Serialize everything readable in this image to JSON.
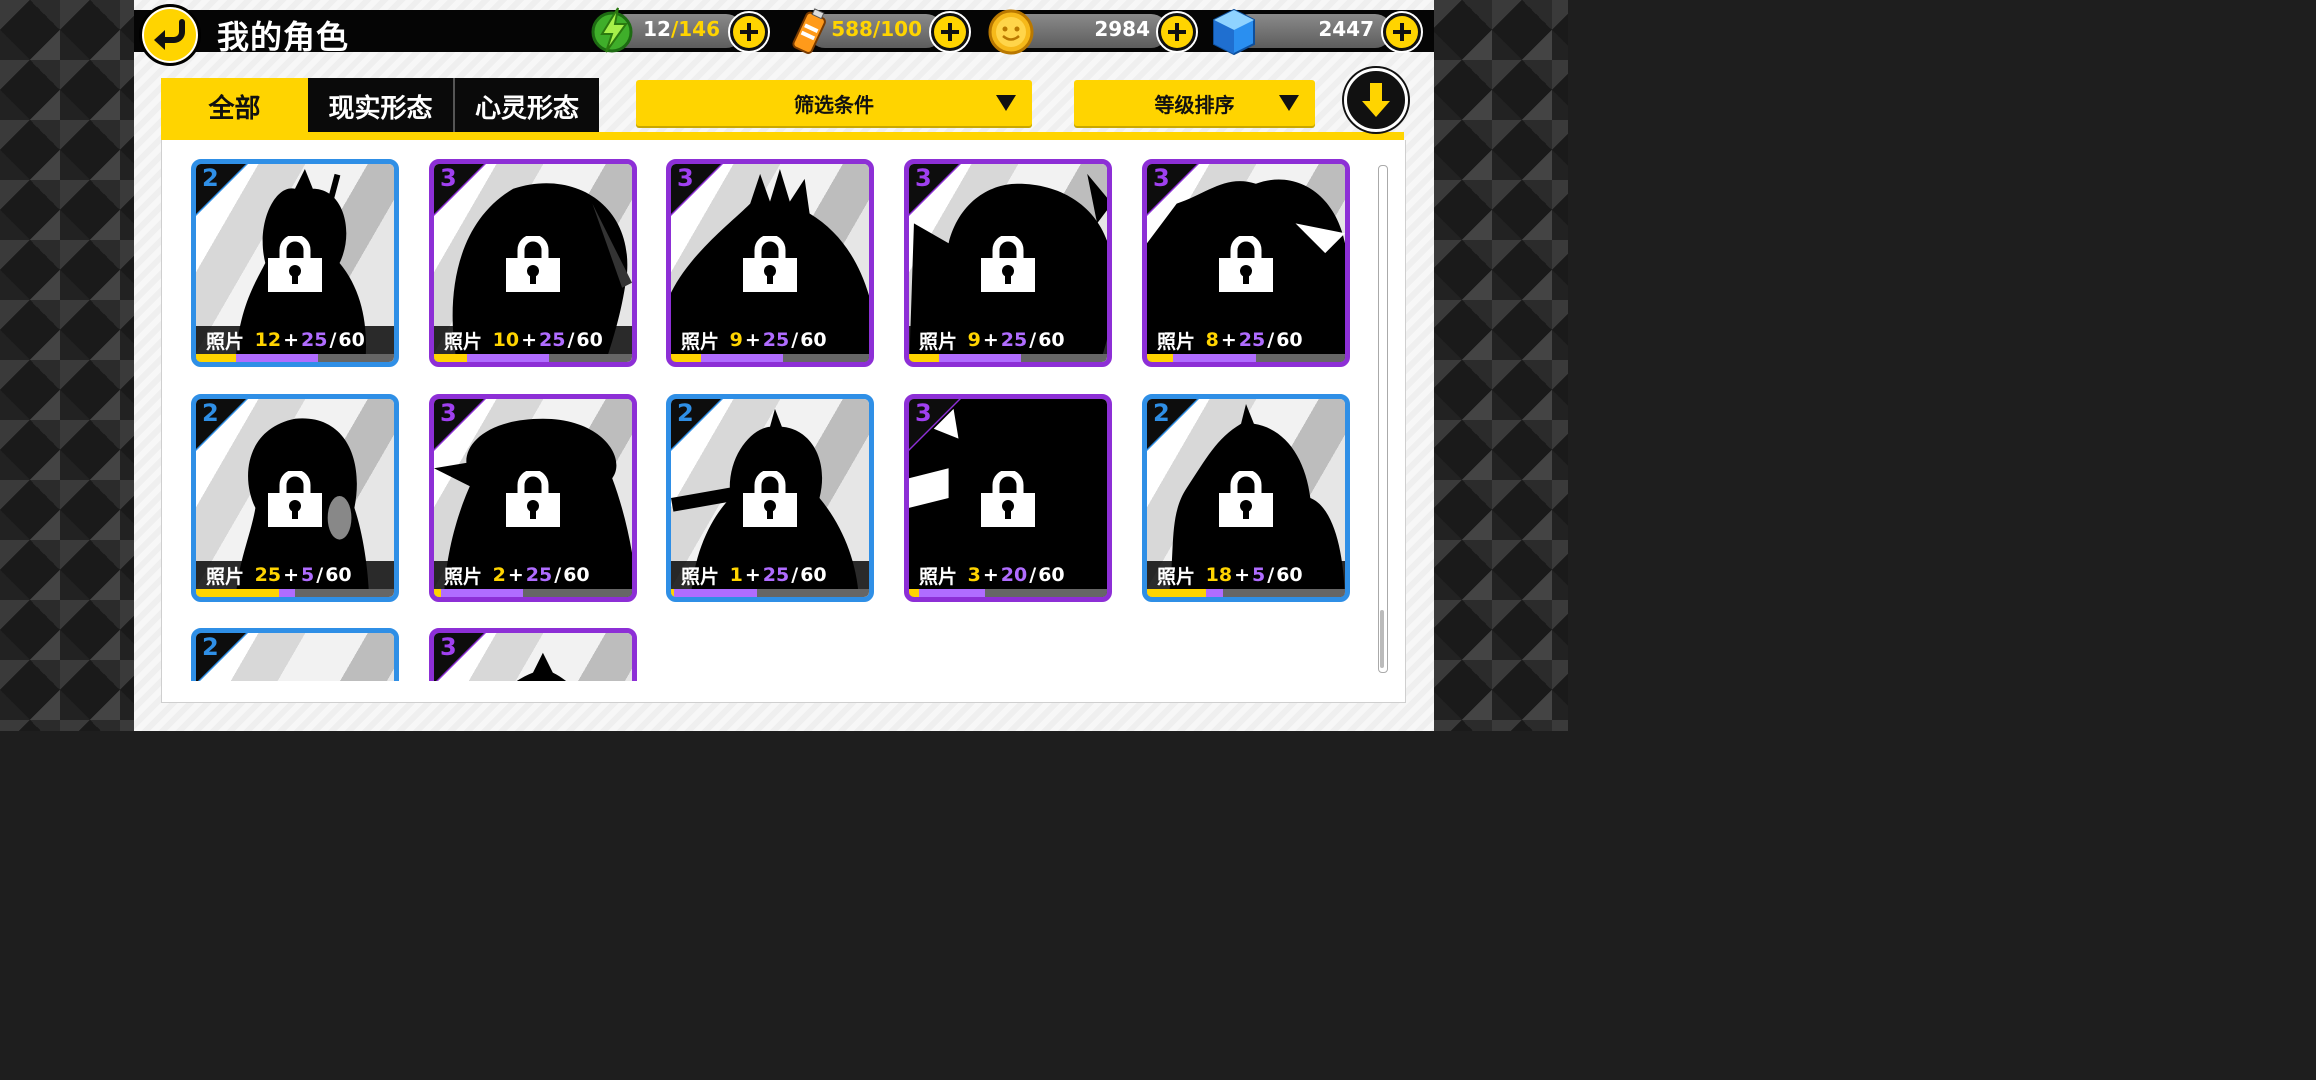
{
  "header": {
    "title": "我的角色"
  },
  "resources": {
    "energy": {
      "current": "12",
      "max": "/146"
    },
    "battery": {
      "value": "588/100"
    },
    "coins": {
      "value": "2984"
    },
    "gems": {
      "value": "2447"
    }
  },
  "tabs": [
    {
      "label": "全部",
      "active": true
    },
    {
      "label": "现实形态",
      "active": false
    },
    {
      "label": "心灵形态",
      "active": false
    }
  ],
  "filters": {
    "filter_label": "筛选条件",
    "sort_label": "等级排序"
  },
  "colors": {
    "accent": "#ffd400",
    "rank2": "#2f8fe6",
    "rank3": "#8d2fd6"
  },
  "cards": [
    {
      "rank": "2",
      "label": "照片",
      "owned": 12,
      "bonus": 25,
      "total": 60
    },
    {
      "rank": "3",
      "label": "照片",
      "owned": 10,
      "bonus": 25,
      "total": 60
    },
    {
      "rank": "3",
      "label": "照片",
      "owned": 9,
      "bonus": 25,
      "total": 60
    },
    {
      "rank": "3",
      "label": "照片",
      "owned": 9,
      "bonus": 25,
      "total": 60
    },
    {
      "rank": "3",
      "label": "照片",
      "owned": 8,
      "bonus": 25,
      "total": 60
    },
    {
      "rank": "2",
      "label": "照片",
      "owned": 25,
      "bonus": 5,
      "total": 60
    },
    {
      "rank": "3",
      "label": "照片",
      "owned": 2,
      "bonus": 25,
      "total": 60
    },
    {
      "rank": "2",
      "label": "照片",
      "owned": 1,
      "bonus": 25,
      "total": 60
    },
    {
      "rank": "3",
      "label": "照片",
      "owned": 3,
      "bonus": 20,
      "total": 60
    },
    {
      "rank": "2",
      "label": "照片",
      "owned": 18,
      "bonus": 5,
      "total": 60
    },
    {
      "rank": "2"
    },
    {
      "rank": "3"
    }
  ]
}
